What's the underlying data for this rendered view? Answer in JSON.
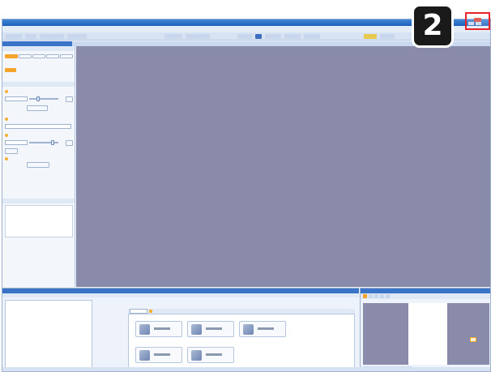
{
  "annotation": {
    "step_number": "2"
  },
  "colors": {
    "work_area": "#8a8aab",
    "accent_blue": "#3a74c8",
    "highlight_red": "#e8232a",
    "accent_orange": "#f4a42a"
  },
  "icons": {
    "close": "close-icon",
    "minimize": "minimize-icon",
    "maximize": "maximize-icon"
  }
}
